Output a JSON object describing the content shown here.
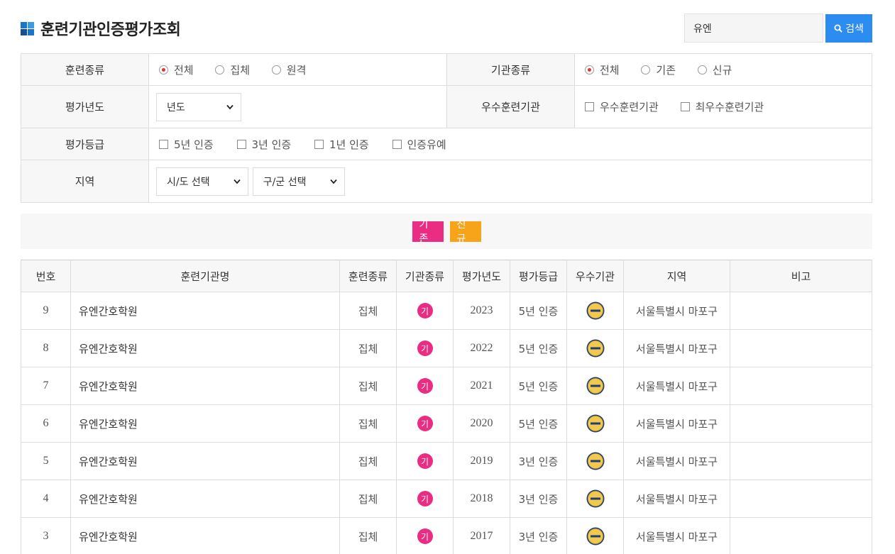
{
  "header": {
    "title": "훈련기관인증평가조회",
    "search_value": "유엔",
    "search_button": "검색"
  },
  "filters": {
    "training_type": {
      "label": "훈련종류",
      "options": [
        "전체",
        "집체",
        "원격"
      ],
      "selected": "전체"
    },
    "institution_type": {
      "label": "기관종류",
      "options": [
        "전체",
        "기존",
        "신규"
      ],
      "selected": "전체"
    },
    "eval_year": {
      "label": "평가년도",
      "select_value": "년도"
    },
    "excellent": {
      "label": "우수훈련기관",
      "options": [
        "우수훈련기관",
        "최우수훈련기관"
      ]
    },
    "grade": {
      "label": "평가등급",
      "options": [
        "5년 인증",
        "3년 인증",
        "1년 인증",
        "인증유예"
      ]
    },
    "region": {
      "label": "지역",
      "sido": "시/도 선택",
      "gugun": "구/군 선택"
    }
  },
  "legend": {
    "existing": "기존",
    "new": "신규"
  },
  "colors": {
    "accent_blue": "#2d8cf0",
    "existing_pink": "#ea2c83",
    "new_orange": "#f7a41b",
    "radio_red": "#e83030"
  },
  "table": {
    "columns": [
      "번호",
      "훈련기관명",
      "훈련종류",
      "기관종류",
      "평가년도",
      "평가등급",
      "우수기관",
      "지역",
      "비고"
    ],
    "rows": [
      {
        "no": "9",
        "name": "유엔간호학원",
        "type": "집체",
        "inst": "기",
        "year": "2023",
        "grade": "5년 인증",
        "region": "서울특별시 마포구",
        "note": ""
      },
      {
        "no": "8",
        "name": "유엔간호학원",
        "type": "집체",
        "inst": "기",
        "year": "2022",
        "grade": "5년 인증",
        "region": "서울특별시 마포구",
        "note": ""
      },
      {
        "no": "7",
        "name": "유엔간호학원",
        "type": "집체",
        "inst": "기",
        "year": "2021",
        "grade": "5년 인증",
        "region": "서울특별시 마포구",
        "note": ""
      },
      {
        "no": "6",
        "name": "유엔간호학원",
        "type": "집체",
        "inst": "기",
        "year": "2020",
        "grade": "5년 인증",
        "region": "서울특별시 마포구",
        "note": ""
      },
      {
        "no": "5",
        "name": "유엔간호학원",
        "type": "집체",
        "inst": "기",
        "year": "2019",
        "grade": "3년 인증",
        "region": "서울특별시 마포구",
        "note": ""
      },
      {
        "no": "4",
        "name": "유엔간호학원",
        "type": "집체",
        "inst": "기",
        "year": "2018",
        "grade": "3년 인증",
        "region": "서울특별시 마포구",
        "note": ""
      },
      {
        "no": "3",
        "name": "유엔간호학원",
        "type": "집체",
        "inst": "기",
        "year": "2017",
        "grade": "3년 인증",
        "region": "서울특별시 마포구",
        "note": ""
      }
    ]
  }
}
